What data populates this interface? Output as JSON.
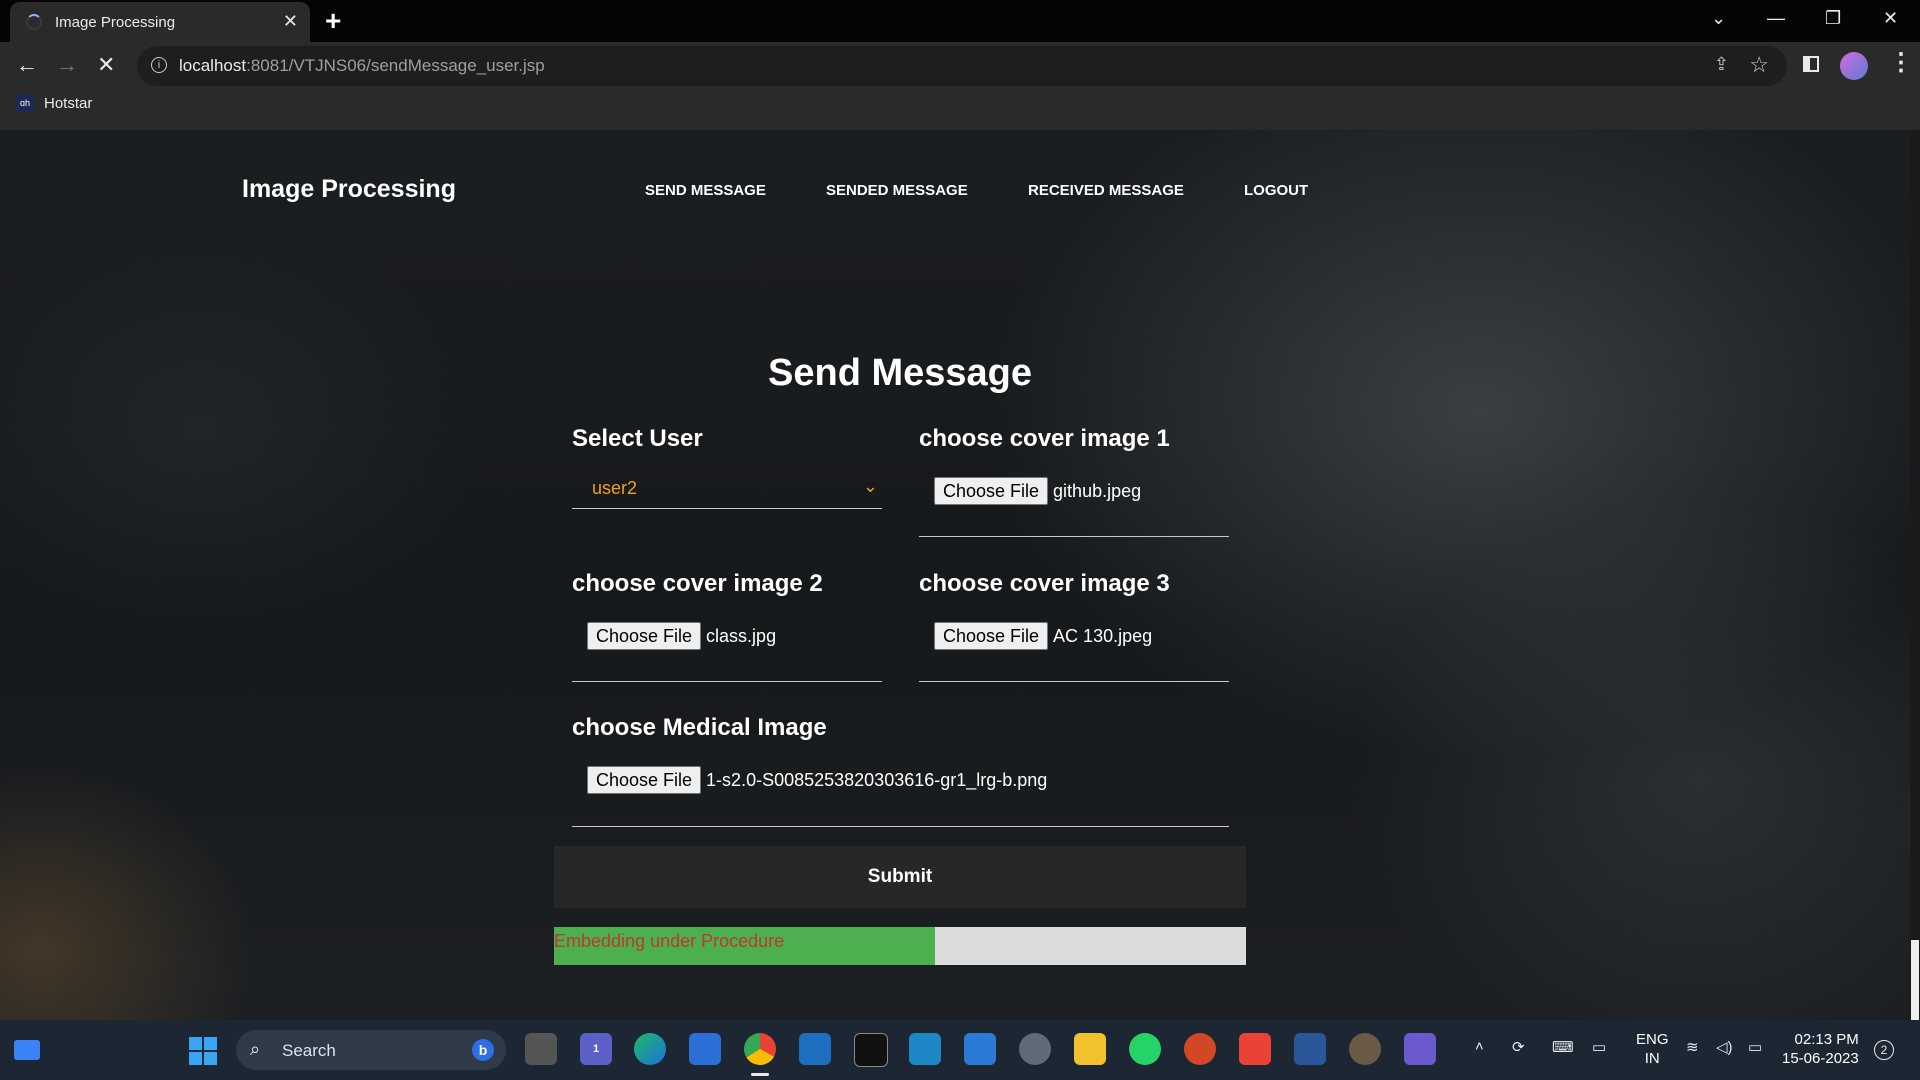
{
  "browser": {
    "tab_title": "Image Processing",
    "tab_close": "✕",
    "new_tab": "+",
    "url_host": "localhost",
    "url_path": ":8081/VTJNS06/sendMessage_user.jsp",
    "bookmark_label": "Hotstar",
    "bookmark_icon_text": "ɑh",
    "accent_color": "#8ab4f8"
  },
  "site": {
    "brand": "Image Processing",
    "nav": [
      "SEND MESSAGE",
      "SENDED MESSAGE",
      "RECEIVED MESSAGE",
      "LOGOUT"
    ]
  },
  "form": {
    "heading": "Send Message",
    "select_user_label": "Select User",
    "select_user_value": "user2",
    "cover1_label": "choose cover image 1",
    "cover1_file": "github.jpeg",
    "cover2_label": "choose cover image 2",
    "cover2_file": "class.jpg",
    "cover3_label": "choose cover image 3",
    "cover3_file": "AC 130.jpeg",
    "medical_label": "choose Medical Image",
    "medical_file": "1-s2.0-S0085253820303616-gr1_lrg-b.png",
    "choose_file_button": "Choose File",
    "submit": "Submit",
    "progress_text": "Embedding under Procedure",
    "progress_fraction": 0.55,
    "select_color": "#f0a020",
    "progress_color": "#4caf50",
    "progress_text_color": "#c0392b"
  },
  "taskbar": {
    "search_placeholder": "Search",
    "teams_badge": "1",
    "lang_line1": "ENG",
    "lang_line2": "IN",
    "time": "02:13 PM",
    "date": "15-06-2023",
    "notification_count": "2"
  }
}
